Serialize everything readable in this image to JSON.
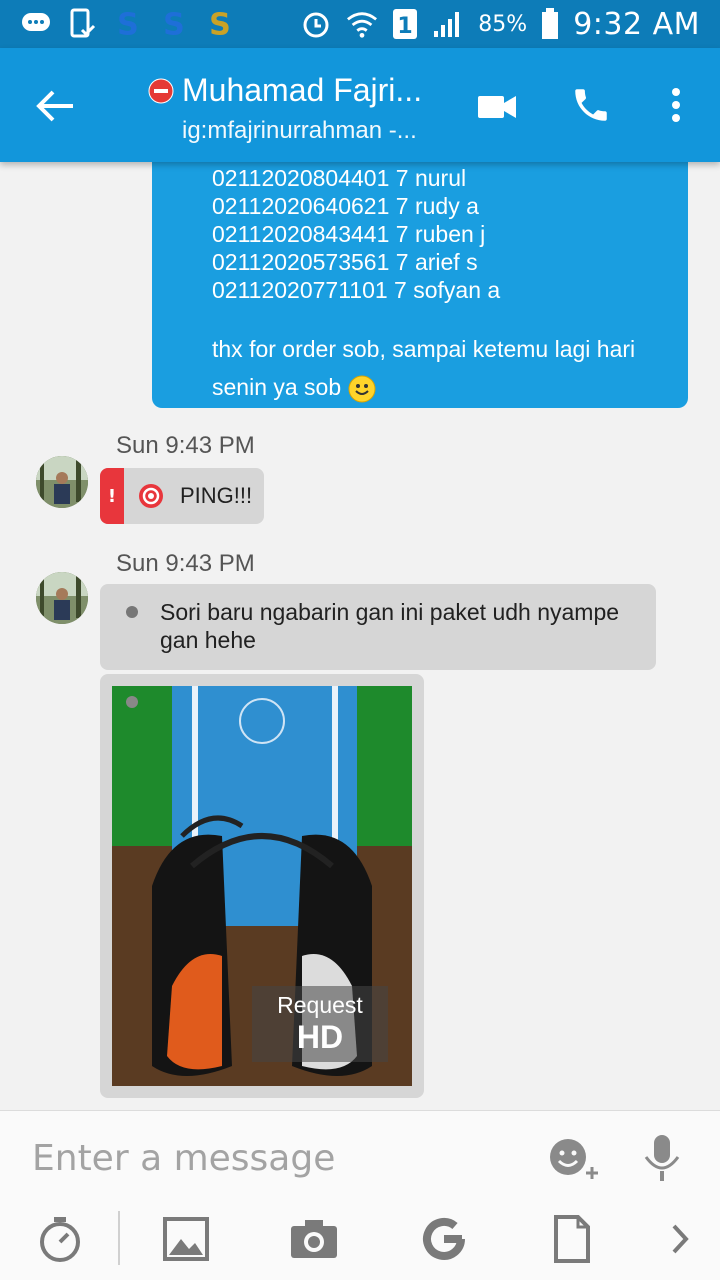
{
  "status_bar": {
    "battery_percent": "85%",
    "time": "9:32 AM",
    "sim_slot": "1",
    "icons": [
      "chat-bubble-icon",
      "phone-check-icon",
      "s-app-icon",
      "s-app-icon",
      "s-app-icon",
      "alarm-icon",
      "wifi-icon",
      "sim-icon",
      "signal-icon",
      "battery-icon"
    ]
  },
  "header": {
    "contact_name": "Muhamad Fajri...",
    "subtitle": "ig:mfajrinurrahman -...",
    "status_color": "#e53935",
    "accent": "#1296db"
  },
  "conversation": {
    "outgoing_lines": [
      "02112020804401 7 nurul",
      "02112020640621 7 rudy a",
      "02112020843441 7 ruben j",
      "02112020573561 7 arief s",
      "02112020771101 7 sofyan a"
    ],
    "outgoing_thanks": "thx for order sob, sampai ketemu lagi hari senin ya sob",
    "ping_timestamp": "Sun 9:43 PM",
    "ping_text": "PING!!!",
    "msg_timestamp": "Sun 9:43 PM",
    "msg_text": "Sori baru ngabarin gan ini paket udh nyampe gan hehe",
    "image_request_line1": "Request",
    "image_request_line2": "HD"
  },
  "composer": {
    "placeholder": "Enter a message",
    "tools": [
      "timer-icon",
      "gallery-icon",
      "camera-icon",
      "google-icon",
      "file-icon",
      "chevron-right-icon"
    ]
  }
}
